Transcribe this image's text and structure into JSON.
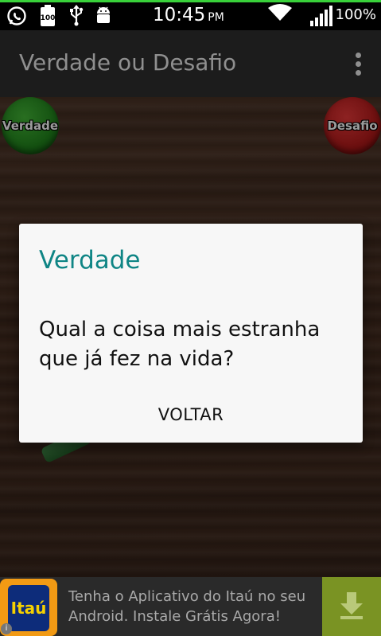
{
  "status_bar": {
    "time": "10:45",
    "ampm": "PM",
    "battery": "100%",
    "icons": [
      "whatsapp-icon",
      "battery-100-icon",
      "usb-icon",
      "android-icon",
      "wifi-icon",
      "signal-icon"
    ],
    "notification_line_color": "#39d13a"
  },
  "action_bar": {
    "title": "Verdade ou Desafio",
    "menu_icon": "overflow-menu-icon"
  },
  "game": {
    "truth_button": "Verdade",
    "dare_button": "Desafio",
    "truth_color": "#2a8f24",
    "dare_color": "#b81c1c"
  },
  "dialog": {
    "title": "Verdade",
    "message": "Qual a coisa mais estranha que já fez na vida?",
    "button": "VOLTAR",
    "title_color": "#0f8585"
  },
  "ad": {
    "logo_text": "Itaú",
    "text": "Tenha o Aplicativo do Itaú no seu Android. Instale Grátis Agora!",
    "download_icon": "download-icon",
    "info_icon": "info-icon"
  }
}
